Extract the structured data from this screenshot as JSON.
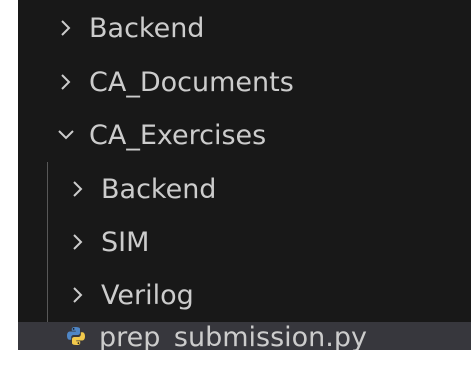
{
  "explorer": {
    "items": [
      {
        "label": "Backend",
        "type": "folder",
        "expanded": false
      },
      {
        "label": "CA_Documents",
        "type": "folder",
        "expanded": false
      },
      {
        "label": "CA_Exercises",
        "type": "folder",
        "expanded": true
      },
      {
        "label": "Backend",
        "type": "folder",
        "expanded": false
      },
      {
        "label": "SIM",
        "type": "folder",
        "expanded": false
      },
      {
        "label": "Verilog",
        "type": "folder",
        "expanded": false
      },
      {
        "label": "prep_submission.py",
        "type": "file",
        "icon": "python-icon",
        "selected": true
      }
    ]
  },
  "colors": {
    "background": "#181818",
    "text": "#cccccc",
    "selected_row": "#37373d",
    "indent_guide": "#585858",
    "python_blue": "#4f86c6",
    "python_yellow": "#f2c94c"
  }
}
